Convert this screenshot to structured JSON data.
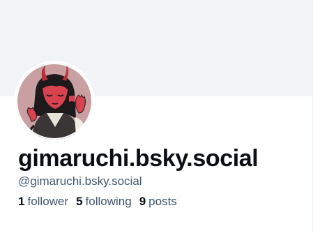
{
  "profile": {
    "display_name": "gimaruchi.bsky.social",
    "handle": "@gimaruchi.bsky.social",
    "avatar_icon": "avatar-illustration",
    "colors": {
      "banner": "#f1f3f5",
      "name": "#0b0f14",
      "muted": "#42576c"
    }
  },
  "stats": {
    "followers": {
      "count": "1",
      "label": "follower"
    },
    "following": {
      "count": "5",
      "label": "following"
    },
    "posts": {
      "count": "9",
      "label": "posts"
    }
  }
}
